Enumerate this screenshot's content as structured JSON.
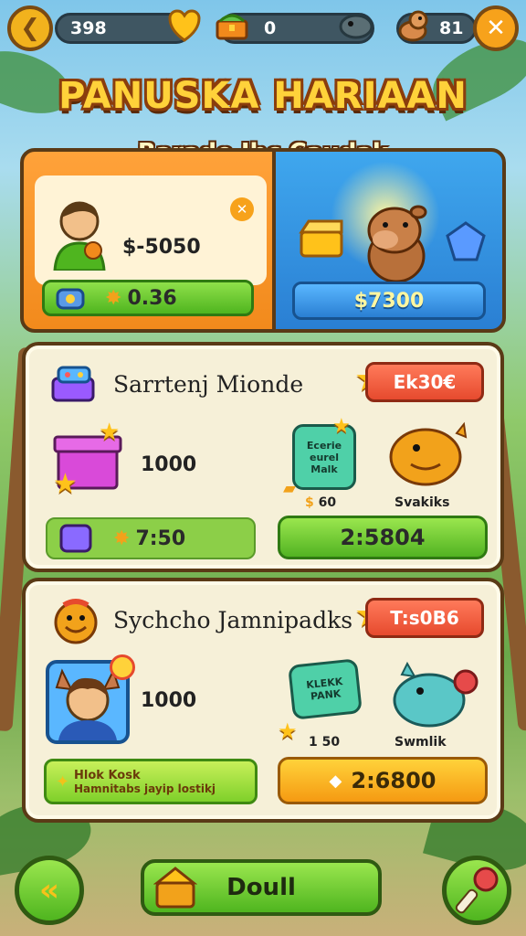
{
  "top_bar": {
    "stat_1": "398",
    "stat_2": "0",
    "stat_3": "81",
    "icons": [
      "back-arrow-icon",
      "heart-shield-icon",
      "treasure-chest-icon",
      "dino-head-icon",
      "pet-icon",
      "close-icon"
    ]
  },
  "header": {
    "title": "PANUSKA HARIAAN",
    "subtitle": "Barade Ibc Caudak"
  },
  "featured": {
    "left": {
      "price": "$-5050",
      "bar_value": "0.36"
    },
    "right": {
      "button_label": "$7300"
    }
  },
  "offers": [
    {
      "title": "Sarrtenj Mionde",
      "price_tag": "Ek30€",
      "quantity": "1000",
      "sign_lines": [
        "Ecerie",
        "eurel",
        "Malk"
      ],
      "small_count": "60",
      "creature_label": "Svakiks",
      "timer": "7:50",
      "buy_label": "2:5804"
    },
    {
      "title": "Sychcho Jamnipadks",
      "price_tag": "T:s0B6",
      "quantity": "1000",
      "sign_lines": [
        "KLEKK",
        "PANK"
      ],
      "small_count": "1 50",
      "creature_label": "Swmlik",
      "promo_line_1": "Hlok Kosk",
      "promo_line_2": "Hamnitabs jayip lostikj",
      "buy_label": "2:6800"
    }
  ],
  "bottom_nav": {
    "main_label": "Doull"
  },
  "colors": {
    "accent_orange": "#f28a1c",
    "accent_blue": "#2a7fd3",
    "accent_green": "#4fb51f",
    "card_bg": "#f6f0d8",
    "price_red": "#e64a2e"
  }
}
